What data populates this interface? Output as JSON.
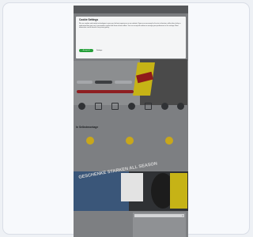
{
  "window": {
    "kind": "mobile-screenshot-card"
  },
  "colors": {
    "accent_yellow": "#c6b316",
    "accent_red": "#8f1b1b",
    "accept_green": "#26a03a"
  },
  "cookie_modal": {
    "title": "Cookie Settings",
    "body": "We use cookies and similar technologies to give you the best experience on our website. Some are necessary for the site to function, while others help us understand how you use it, personalise content and show relevant offers. You can accept all cookies or manage your preferences in the settings. More information can be found in our privacy policy.",
    "accept_label": "Accept all",
    "settings_label": "Settings"
  },
  "hero": {
    "caption": ""
  },
  "categories": [
    {
      "icon": "tyre-icon",
      "label": ""
    },
    {
      "icon": "car-icon",
      "label": ""
    },
    {
      "icon": "rim-icon",
      "label": ""
    },
    {
      "icon": "battery-icon",
      "label": ""
    },
    {
      "icon": "shop-icon",
      "label": ""
    },
    {
      "icon": "gauge-icon",
      "label": ""
    },
    {
      "icon": "contrast-icon",
      "label": ""
    }
  ],
  "section": {
    "title": "In Selbstmontage"
  },
  "features": [
    {
      "icon": "truck-icon",
      "label": "",
      "sub": ""
    },
    {
      "icon": "tag-icon",
      "label": "",
      "sub": ""
    },
    {
      "icon": "clock-icon",
      "label": "",
      "sub": ""
    }
  ],
  "promo": {
    "headline": "GESCHENKE STARKEN ALL SEASON",
    "label": ""
  },
  "bottom": {
    "left_text": "",
    "right_input_close": "×"
  }
}
